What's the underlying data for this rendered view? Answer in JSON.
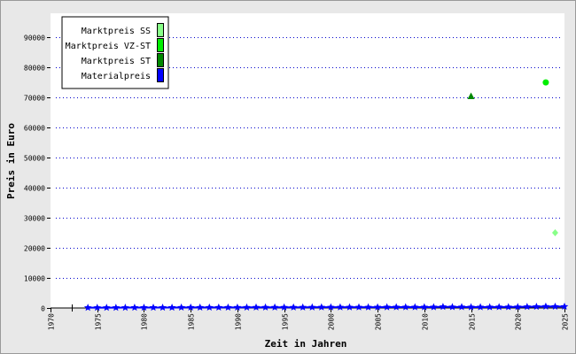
{
  "colors": {
    "outer_background": "#e8e8e8",
    "plot_background": "#ffffff",
    "grid": "#0000cc",
    "axis": "#000000",
    "frame": "#999999"
  },
  "chart_data": {
    "type": "scatter",
    "title": "",
    "xlabel": "Zeit in Jahren",
    "ylabel": "Preis in Euro",
    "xlim": [
      1970,
      2025
    ],
    "ylim": [
      0,
      98000
    ],
    "grid": true,
    "grid_axis": "y",
    "legend_position": "top-left",
    "x_ticks": [
      1970,
      1975,
      1980,
      1985,
      1990,
      1995,
      2000,
      2005,
      2010,
      2015,
      2020,
      2025
    ],
    "x_tick_labels": [
      "1970",
      "1975",
      "1980",
      "1985",
      "1990",
      "1995",
      "2000",
      "2005",
      "2010",
      "2015",
      "2020",
      "2025"
    ],
    "y_ticks": [
      0,
      10000,
      20000,
      30000,
      40000,
      50000,
      60000,
      70000,
      80000,
      90000
    ],
    "y_tick_labels": [
      "0",
      "10000",
      "20000",
      "30000",
      "40000",
      "50000",
      "60000",
      "70000",
      "80000",
      "90000"
    ],
    "series": [
      {
        "name": "Marktpreis SS",
        "color": "#88ff88",
        "marker": "diamond",
        "points": [
          [
            2024,
            25000
          ]
        ]
      },
      {
        "name": "Marktpreis VZ-ST",
        "color": "#00ee00",
        "marker": "circle",
        "points": [
          [
            2023,
            75000
          ]
        ]
      },
      {
        "name": "Marktpreis ST",
        "color": "#008800",
        "marker": "triangle",
        "points": [
          [
            2015,
            70500
          ]
        ]
      },
      {
        "name": "Materialpreis",
        "color": "#0000ff",
        "marker": "star",
        "connect": true,
        "points": [
          [
            1974,
            100
          ],
          [
            1975,
            110
          ],
          [
            1976,
            120
          ],
          [
            1977,
            125
          ],
          [
            1978,
            130
          ],
          [
            1979,
            140
          ],
          [
            1980,
            150
          ],
          [
            1981,
            155
          ],
          [
            1982,
            160
          ],
          [
            1983,
            165
          ],
          [
            1984,
            170
          ],
          [
            1985,
            175
          ],
          [
            1986,
            180
          ],
          [
            1987,
            185
          ],
          [
            1988,
            190
          ],
          [
            1989,
            195
          ],
          [
            1990,
            200
          ],
          [
            1991,
            205
          ],
          [
            1992,
            210
          ],
          [
            1993,
            215
          ],
          [
            1994,
            220
          ],
          [
            1995,
            225
          ],
          [
            1996,
            230
          ],
          [
            1997,
            235
          ],
          [
            1998,
            240
          ],
          [
            1999,
            245
          ],
          [
            2000,
            250
          ],
          [
            2001,
            255
          ],
          [
            2002,
            260
          ],
          [
            2003,
            265
          ],
          [
            2004,
            270
          ],
          [
            2005,
            275
          ],
          [
            2006,
            280
          ],
          [
            2007,
            285
          ],
          [
            2008,
            290
          ],
          [
            2009,
            295
          ],
          [
            2010,
            300
          ],
          [
            2011,
            310
          ],
          [
            2012,
            400
          ],
          [
            2013,
            320
          ],
          [
            2014,
            330
          ],
          [
            2015,
            300
          ],
          [
            2016,
            300
          ],
          [
            2017,
            310
          ],
          [
            2018,
            320
          ],
          [
            2019,
            330
          ],
          [
            2020,
            350
          ],
          [
            2021,
            400
          ],
          [
            2022,
            450
          ],
          [
            2023,
            500
          ],
          [
            2024,
            480
          ],
          [
            2025,
            470
          ]
        ]
      }
    ]
  }
}
